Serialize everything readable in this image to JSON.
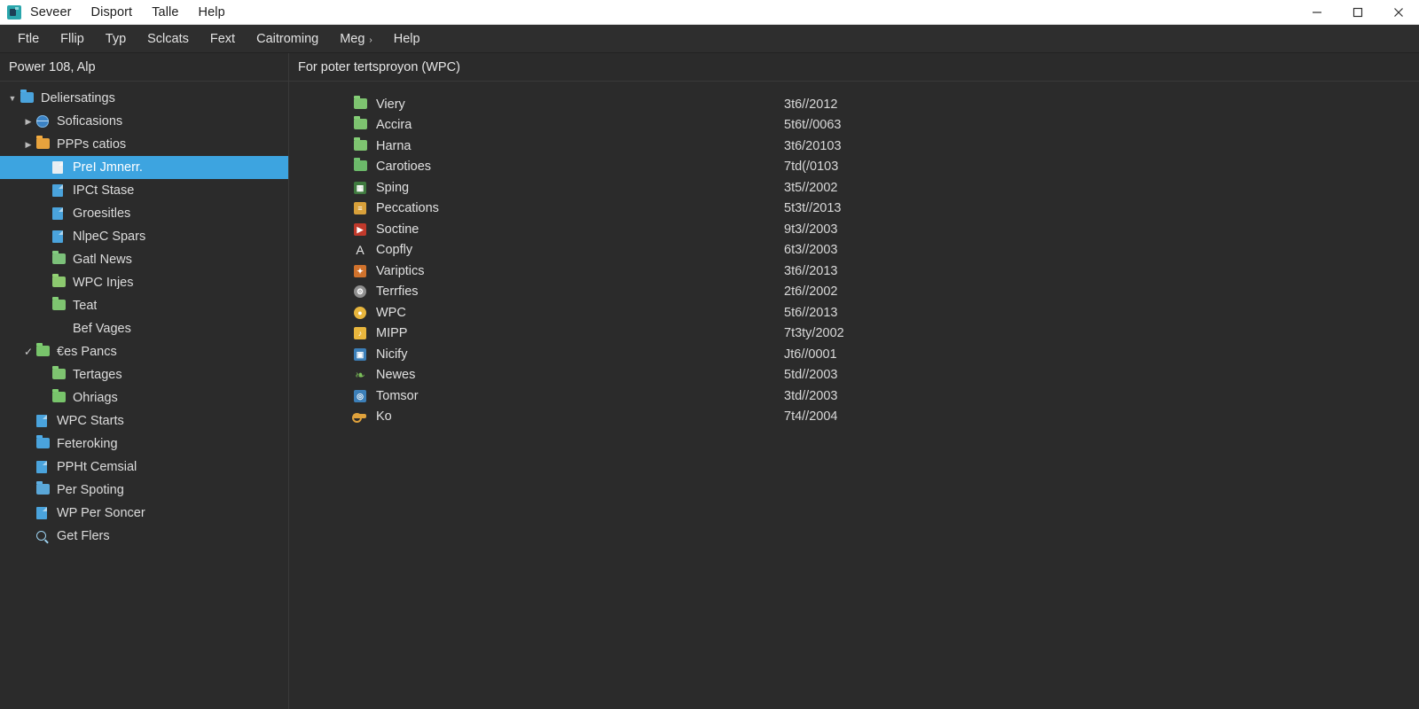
{
  "titlebar": {
    "app_icon": "app-icon",
    "menus": [
      "Seveer",
      "Disport",
      "Talle",
      "Help"
    ],
    "window_controls": {
      "minimize": "minimize-icon",
      "maximize": "maximize-icon",
      "close": "close-icon"
    }
  },
  "menubar": {
    "items": [
      {
        "label": "Ftle",
        "has_chevron": false
      },
      {
        "label": "Fllip",
        "has_chevron": false
      },
      {
        "label": "Typ",
        "has_chevron": false
      },
      {
        "label": "Sclcats",
        "has_chevron": false
      },
      {
        "label": "Fext",
        "has_chevron": false
      },
      {
        "label": "Caitroming",
        "has_chevron": false
      },
      {
        "label": "Meg",
        "has_chevron": true
      },
      {
        "label": "Help",
        "has_chevron": false
      }
    ],
    "chevron": "›"
  },
  "sidebar": {
    "header": "Power 108, Alp",
    "items": [
      {
        "label": "Deliersatings",
        "indent": 0,
        "twisty": "▼",
        "icon": "folder-icon",
        "color": "#4aa3dc",
        "selected": false
      },
      {
        "label": "Soficasions",
        "indent": 1,
        "twisty": "▶",
        "icon": "globe-icon",
        "color": "#3b82c4",
        "selected": false
      },
      {
        "label": "PPPs catios",
        "indent": 1,
        "twisty": "▶",
        "icon": "folder-icon",
        "color": "#e8a33d",
        "selected": false
      },
      {
        "label": "PreI Jmnerr.",
        "indent": 2,
        "twisty": "",
        "icon": "file-icon",
        "color": "#e8eef2",
        "selected": true
      },
      {
        "label": "IPCt Stase",
        "indent": 2,
        "twisty": "",
        "icon": "file-icon",
        "color": "#4aa3dc",
        "selected": false
      },
      {
        "label": "Groesitles",
        "indent": 2,
        "twisty": "",
        "icon": "file-icon",
        "color": "#4aa3dc",
        "selected": false
      },
      {
        "label": "NlpeC Spars",
        "indent": 2,
        "twisty": "",
        "icon": "file-icon",
        "color": "#4aa3dc",
        "selected": false
      },
      {
        "label": "Gatl News",
        "indent": 2,
        "twisty": "",
        "icon": "folder-icon",
        "color": "#7cc17a",
        "selected": false
      },
      {
        "label": "WPC Injes",
        "indent": 2,
        "twisty": "",
        "icon": "folder-icon",
        "color": "#8cc96f",
        "selected": false
      },
      {
        "label": "Teat",
        "indent": 2,
        "twisty": "",
        "icon": "folder-icon",
        "color": "#7ec470",
        "selected": false
      },
      {
        "label": "Bef Vages",
        "indent": 2,
        "twisty": "",
        "icon": "none",
        "color": "#00000000",
        "selected": false
      },
      {
        "label": "€es Pancs",
        "indent": 1,
        "twisty": "✓",
        "icon": "folder-icon",
        "color": "#78c46b",
        "selected": false
      },
      {
        "label": "Tertages",
        "indent": 2,
        "twisty": "",
        "icon": "folder-icon",
        "color": "#7ec470",
        "selected": false
      },
      {
        "label": "Ohriags",
        "indent": 2,
        "twisty": "",
        "icon": "folder-icon",
        "color": "#78c46b",
        "selected": false
      },
      {
        "label": "WPC Starts",
        "indent": 1,
        "twisty": "",
        "icon": "file-icon",
        "color": "#4aa3dc",
        "selected": false
      },
      {
        "label": "Feteroking",
        "indent": 1,
        "twisty": "",
        "icon": "folder-icon",
        "color": "#4aa3dc",
        "selected": false
      },
      {
        "label": "PPHt Cemsial",
        "indent": 1,
        "twisty": "",
        "icon": "file-icon",
        "color": "#4aa3dc",
        "selected": false
      },
      {
        "label": "Per Spoting",
        "indent": 1,
        "twisty": "",
        "icon": "folder-icon",
        "color": "#5aa7d8",
        "selected": false
      },
      {
        "label": "WP Per Soncer",
        "indent": 1,
        "twisty": "",
        "icon": "file-icon",
        "color": "#4aa3dc",
        "selected": false
      },
      {
        "label": "Get Flers",
        "indent": 1,
        "twisty": "",
        "icon": "search-icon",
        "color": "#9dd2f0",
        "selected": false
      }
    ]
  },
  "main": {
    "header": "For poter tertsproyon (WPC)",
    "rows": [
      {
        "name": "Viery",
        "date": "3t6//2012",
        "icon": "folder-icon",
        "style": "folder",
        "color": "#7ec470",
        "glyph": ""
      },
      {
        "name": "Accira",
        "date": "5t6t//0063",
        "icon": "folder-icon",
        "style": "folder",
        "color": "#7ec470",
        "glyph": ""
      },
      {
        "name": "Harna",
        "date": "3t6/20103",
        "icon": "folder-icon",
        "style": "folder",
        "color": "#7ec470",
        "glyph": ""
      },
      {
        "name": "Carotioes",
        "date": "7td(/0103",
        "icon": "folder-icon",
        "style": "folder",
        "color": "#6cb96a",
        "glyph": ""
      },
      {
        "name": "Sping",
        "date": "3t5//2002",
        "icon": "image-icon",
        "style": "box",
        "color": "#3f7a3f",
        "glyph": "▦"
      },
      {
        "name": "Peccations",
        "date": "5t3t//2013",
        "icon": "document-icon",
        "style": "box",
        "color": "#d8a03a",
        "glyph": "≡"
      },
      {
        "name": "Soctine",
        "date": "9t3//2003",
        "icon": "pdf-icon",
        "style": "box",
        "color": "#c0392b",
        "glyph": "▶"
      },
      {
        "name": "Copfly",
        "date": "6t3//2003",
        "icon": "font-icon",
        "style": "glyph",
        "color": "#e8e8e8",
        "glyph": "A"
      },
      {
        "name": "Variptics",
        "date": "3t6//2013",
        "icon": "archive-icon",
        "style": "box",
        "color": "#d0722c",
        "glyph": "✦"
      },
      {
        "name": "Terrfies",
        "date": "2t6//2002",
        "icon": "settings-icon",
        "style": "round",
        "color": "#8f8f8f",
        "glyph": "⚙"
      },
      {
        "name": "WPC",
        "date": "5t6//2013",
        "icon": "coin-icon",
        "style": "round",
        "color": "#e8b63d",
        "glyph": "●"
      },
      {
        "name": "MIPP",
        "date": "7t3ty/2002",
        "icon": "media-icon",
        "style": "box",
        "color": "#e8b63d",
        "glyph": "♪"
      },
      {
        "name": "Nicify",
        "date": "Jt6//0001",
        "icon": "app-icon",
        "style": "box",
        "color": "#3c7fb8",
        "glyph": "▣"
      },
      {
        "name": "Newes",
        "date": "5td//2003",
        "icon": "plant-icon",
        "style": "glyph",
        "color": "#7cc05a",
        "glyph": "❧"
      },
      {
        "name": "Tomsor",
        "date": "3td//2003",
        "icon": "disc-icon",
        "style": "box",
        "color": "#3c7fb8",
        "glyph": "◎"
      },
      {
        "name": "Ko",
        "date": "7t4//2004",
        "icon": "key-icon",
        "style": "key",
        "color": "#e0a23c",
        "glyph": ""
      }
    ]
  },
  "colors": {
    "titlebar_bg": "#ffffff",
    "menubar_bg": "#2e2e2e",
    "app_bg": "#2b2b2b",
    "selection": "#3da4e0",
    "text": "#dcdcdc",
    "divider": "#3a3a3a"
  }
}
